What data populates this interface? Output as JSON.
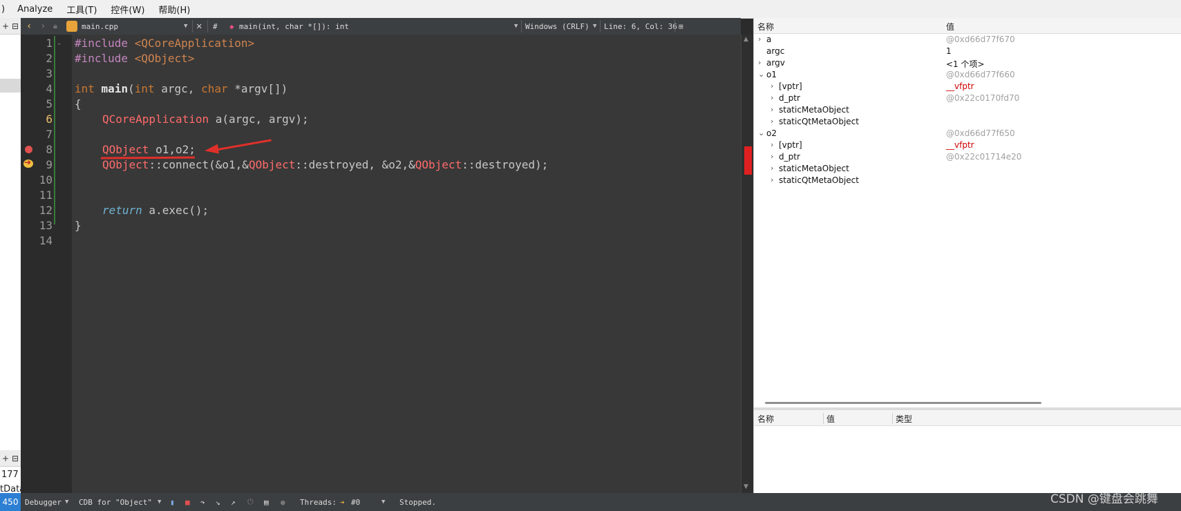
{
  "menu": {
    "edge": ")",
    "items": [
      "Analyze",
      "工具(T)",
      "控件(W)",
      "帮助(H)"
    ]
  },
  "left_panel": {
    "top_plus": "+",
    "bottom_plus": "+",
    "number": "177",
    "label": "tData"
  },
  "editor_header": {
    "file_name": "main.cpp",
    "hash": "#",
    "symbol": "main(int, char *[]): int",
    "line_ending": "Windows (CRLF)",
    "position": "Line: 6, Col: 36"
  },
  "editor": {
    "current_line": 6,
    "breakpoint_line": 8,
    "exec_line": 9,
    "line_numbers": [
      "1",
      "2",
      "3",
      "4",
      "5",
      "6",
      "7",
      "8",
      "9",
      "10",
      "11",
      "12",
      "13",
      "14"
    ],
    "lines": {
      "l1": {
        "directive": "#include",
        "header": " <QCoreApplication>"
      },
      "l2": {
        "directive": "#include",
        "header": " <QObject>"
      },
      "l4": {
        "type": "int",
        "name": "main",
        "open": "(",
        "arg1_type": "int",
        "arg1": " argc, ",
        "arg2_type": "char",
        "arg2": " *argv[])"
      },
      "l5": "{",
      "l6": {
        "cls": "QCoreApplication",
        "rest": " a(argc, argv);"
      },
      "l8": {
        "cls": "QObject",
        "rest": " o1,o2;"
      },
      "l9": {
        "cls1": "QObject",
        "p1": "::connect(&o1,&",
        "cls2": "QObject",
        "p2": "::destroyed, &o2,&",
        "cls3": "QObject",
        "p3": "::destroyed);"
      },
      "l12": {
        "kw": "return",
        "rest": " a.exec();"
      },
      "l13": "}"
    }
  },
  "locals": {
    "col_name": "名称",
    "col_value": "值",
    "rows": [
      {
        "name": "a",
        "value": "@0xd66d77f670",
        "expander": "›",
        "value_style": "gray"
      },
      {
        "name": "argc",
        "value": "1",
        "expander": "",
        "value_style": "black"
      },
      {
        "name": "argv",
        "value": "<1 个项>",
        "expander": "›",
        "value_style": "black"
      },
      {
        "name": "o1",
        "value": "@0xd66d77f660",
        "expander": "⌄",
        "value_style": "gray"
      },
      {
        "name": "[vptr]",
        "value": "__vfptr",
        "expander": "›",
        "value_style": "red"
      },
      {
        "name": "d_ptr",
        "value": "@0x22c0170fd70",
        "expander": "›",
        "value_style": "gray"
      },
      {
        "name": "staticMetaObject",
        "value": "",
        "expander": "›",
        "value_style": "gray"
      },
      {
        "name": "staticQtMetaObject",
        "value": "",
        "expander": "›",
        "value_style": "gray"
      },
      {
        "name": "o2",
        "value": "@0xd66d77f650",
        "expander": "⌄",
        "value_style": "gray"
      },
      {
        "name": "[vptr]",
        "value": "__vfptr",
        "expander": "›",
        "value_style": "red"
      },
      {
        "name": "d_ptr",
        "value": "@0x22c01714e20",
        "expander": "›",
        "value_style": "gray"
      },
      {
        "name": "staticMetaObject",
        "value": "",
        "expander": "›",
        "value_style": "gray"
      },
      {
        "name": "staticQtMetaObject",
        "value": "",
        "expander": "›",
        "value_style": "gray"
      }
    ]
  },
  "expressions": {
    "col_name": "名称",
    "col_value": "值",
    "col_type": "类型"
  },
  "statusbar": {
    "number": "450",
    "debugger": "Debugger",
    "engine": "CDB for \"Object\"",
    "threads_label": "Threads:",
    "thread": "#0",
    "status": "Stopped.",
    "watermark": "CSDN @键盘会跳舞"
  }
}
